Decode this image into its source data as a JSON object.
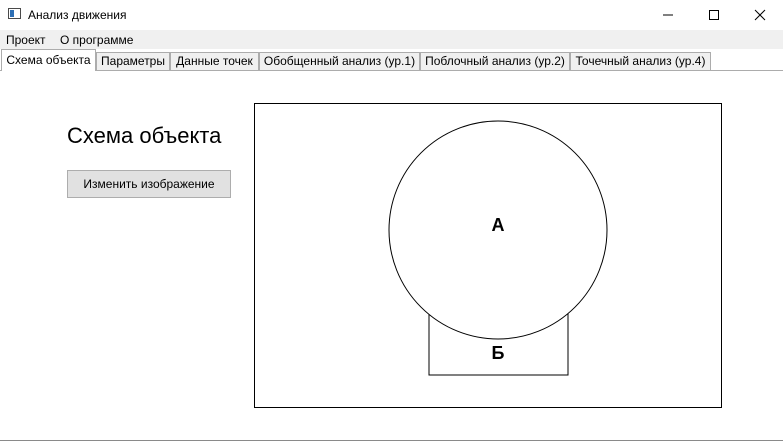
{
  "window": {
    "title": "Анализ движения"
  },
  "menu": [
    {
      "label": "Проект"
    },
    {
      "label": "О программе"
    }
  ],
  "tabs": [
    {
      "label": "Схема объекта",
      "active": true
    },
    {
      "label": "Параметры"
    },
    {
      "label": "Данные точек"
    },
    {
      "label": "Обобщенный анализ (ур.1)"
    },
    {
      "label": "Поблочный анализ (ур.2)"
    },
    {
      "label": "Точечный анализ (ур.4)"
    }
  ],
  "main": {
    "heading": "Схема объекта",
    "change_image_button": "Изменить изображение"
  },
  "diagram": {
    "circle_label": "А",
    "rect_label": "Б"
  }
}
